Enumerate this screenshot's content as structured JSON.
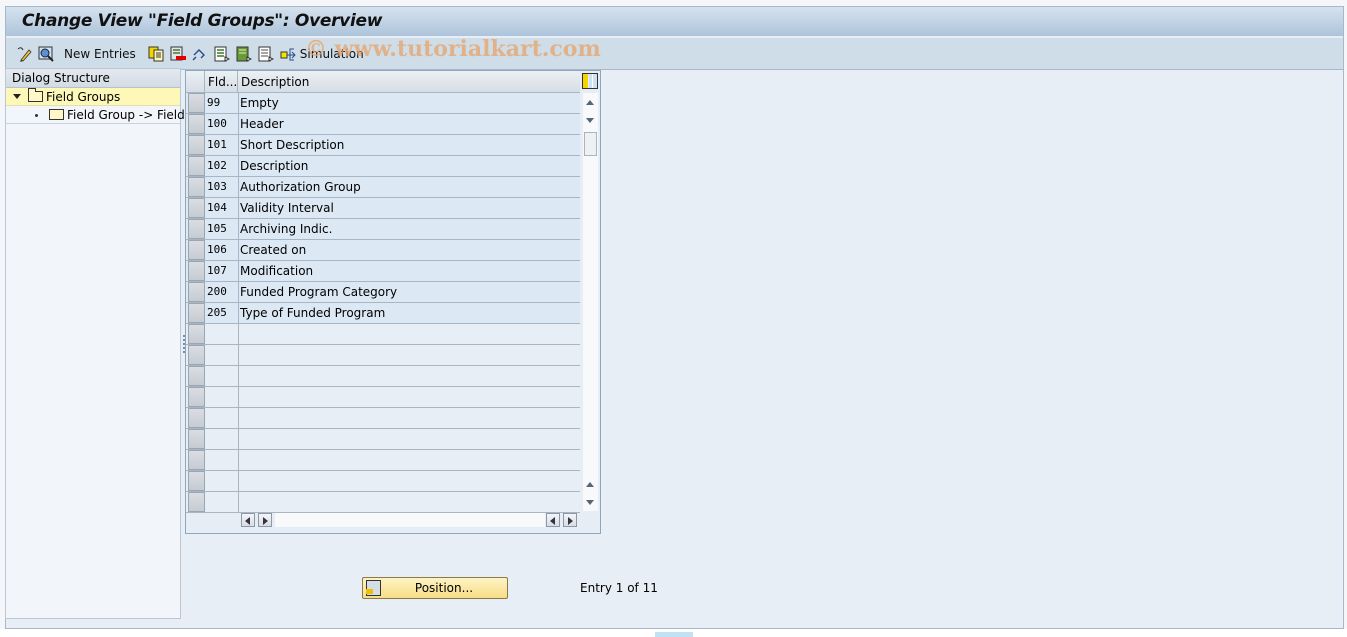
{
  "window": {
    "title": "Change View \"Field Groups\": Overview"
  },
  "toolbar": {
    "items": [
      {
        "icon": "display-change-icon",
        "label": ""
      },
      {
        "icon": "find-icon",
        "label": ""
      },
      {
        "icon": "",
        "label": "New Entries"
      },
      {
        "icon": "copy-as-icon",
        "label": ""
      },
      {
        "icon": "delete-icon",
        "label": ""
      },
      {
        "icon": "undo-change-icon",
        "label": ""
      },
      {
        "icon": "select-all-icon",
        "label": ""
      },
      {
        "icon": "select-block-icon",
        "label": ""
      },
      {
        "icon": "deselect-all-icon",
        "label": ""
      },
      {
        "icon": "simulation-icon",
        "label": "Simulation"
      }
    ],
    "new_entries_label": "New Entries",
    "simulation_label": "Simulation",
    "watermark": "© www.tutorialkart.com"
  },
  "dialog_structure": {
    "header": "Dialog Structure",
    "nodes": [
      {
        "label": "Field Groups",
        "level": 0,
        "expanded": true,
        "selected": true
      },
      {
        "label": "Field Group -> Fields",
        "level": 1,
        "expanded": false,
        "selected": false
      }
    ]
  },
  "table": {
    "columns": [
      "Fld...",
      "Description"
    ],
    "rows": [
      {
        "fld": "99",
        "description": "Empty"
      },
      {
        "fld": "100",
        "description": "Header"
      },
      {
        "fld": "101",
        "description": "Short Description"
      },
      {
        "fld": "102",
        "description": "Description"
      },
      {
        "fld": "103",
        "description": "Authorization Group"
      },
      {
        "fld": "104",
        "description": "Validity Interval"
      },
      {
        "fld": "105",
        "description": "Archiving Indic."
      },
      {
        "fld": "106",
        "description": "Created on"
      },
      {
        "fld": "107",
        "description": "Modification"
      },
      {
        "fld": "200",
        "description": "Funded Program Category"
      },
      {
        "fld": "205",
        "description": "Type of Funded Program"
      }
    ],
    "empty_rows": 9
  },
  "footer": {
    "position_label": "Position...",
    "entry_info": "Entry 1 of 11"
  }
}
